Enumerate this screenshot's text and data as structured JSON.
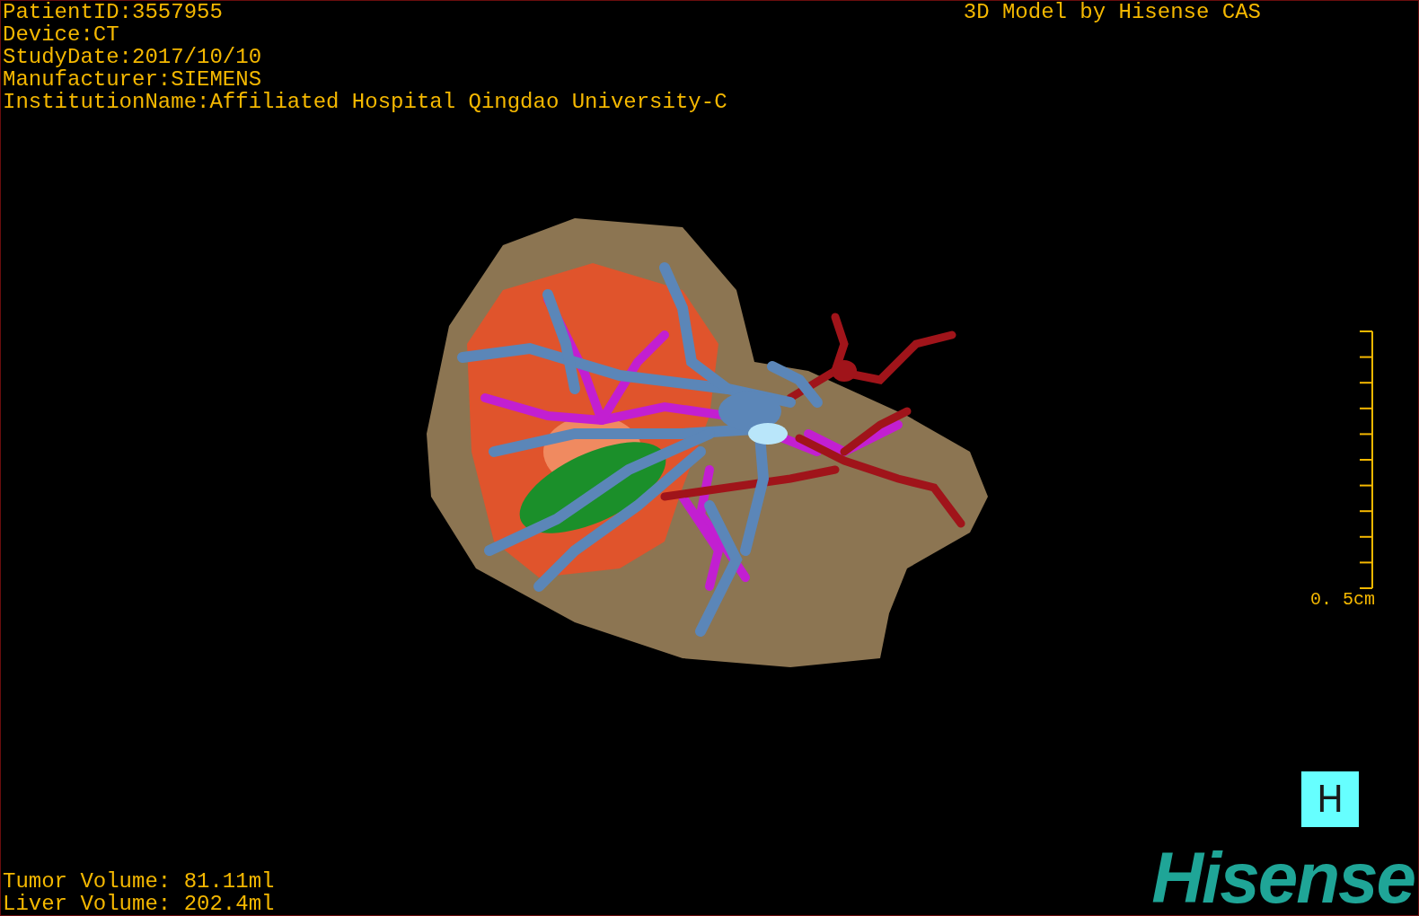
{
  "viewport": {
    "info_lines": [
      "PatientID:3557955",
      "Device:CT",
      "StudyDate:2017/10/10",
      "Manufacturer:SIEMENS",
      "InstitutionName:Affiliated Hospital Qingdao University-C"
    ],
    "title": "3D Model by Hisense CAS",
    "scale_label": "0. 5cm",
    "volumes": [
      "Tumor Volume: 81.11ml",
      "Liver Volume: 202.4ml"
    ],
    "view_button": "H",
    "logo": "Hisense"
  }
}
